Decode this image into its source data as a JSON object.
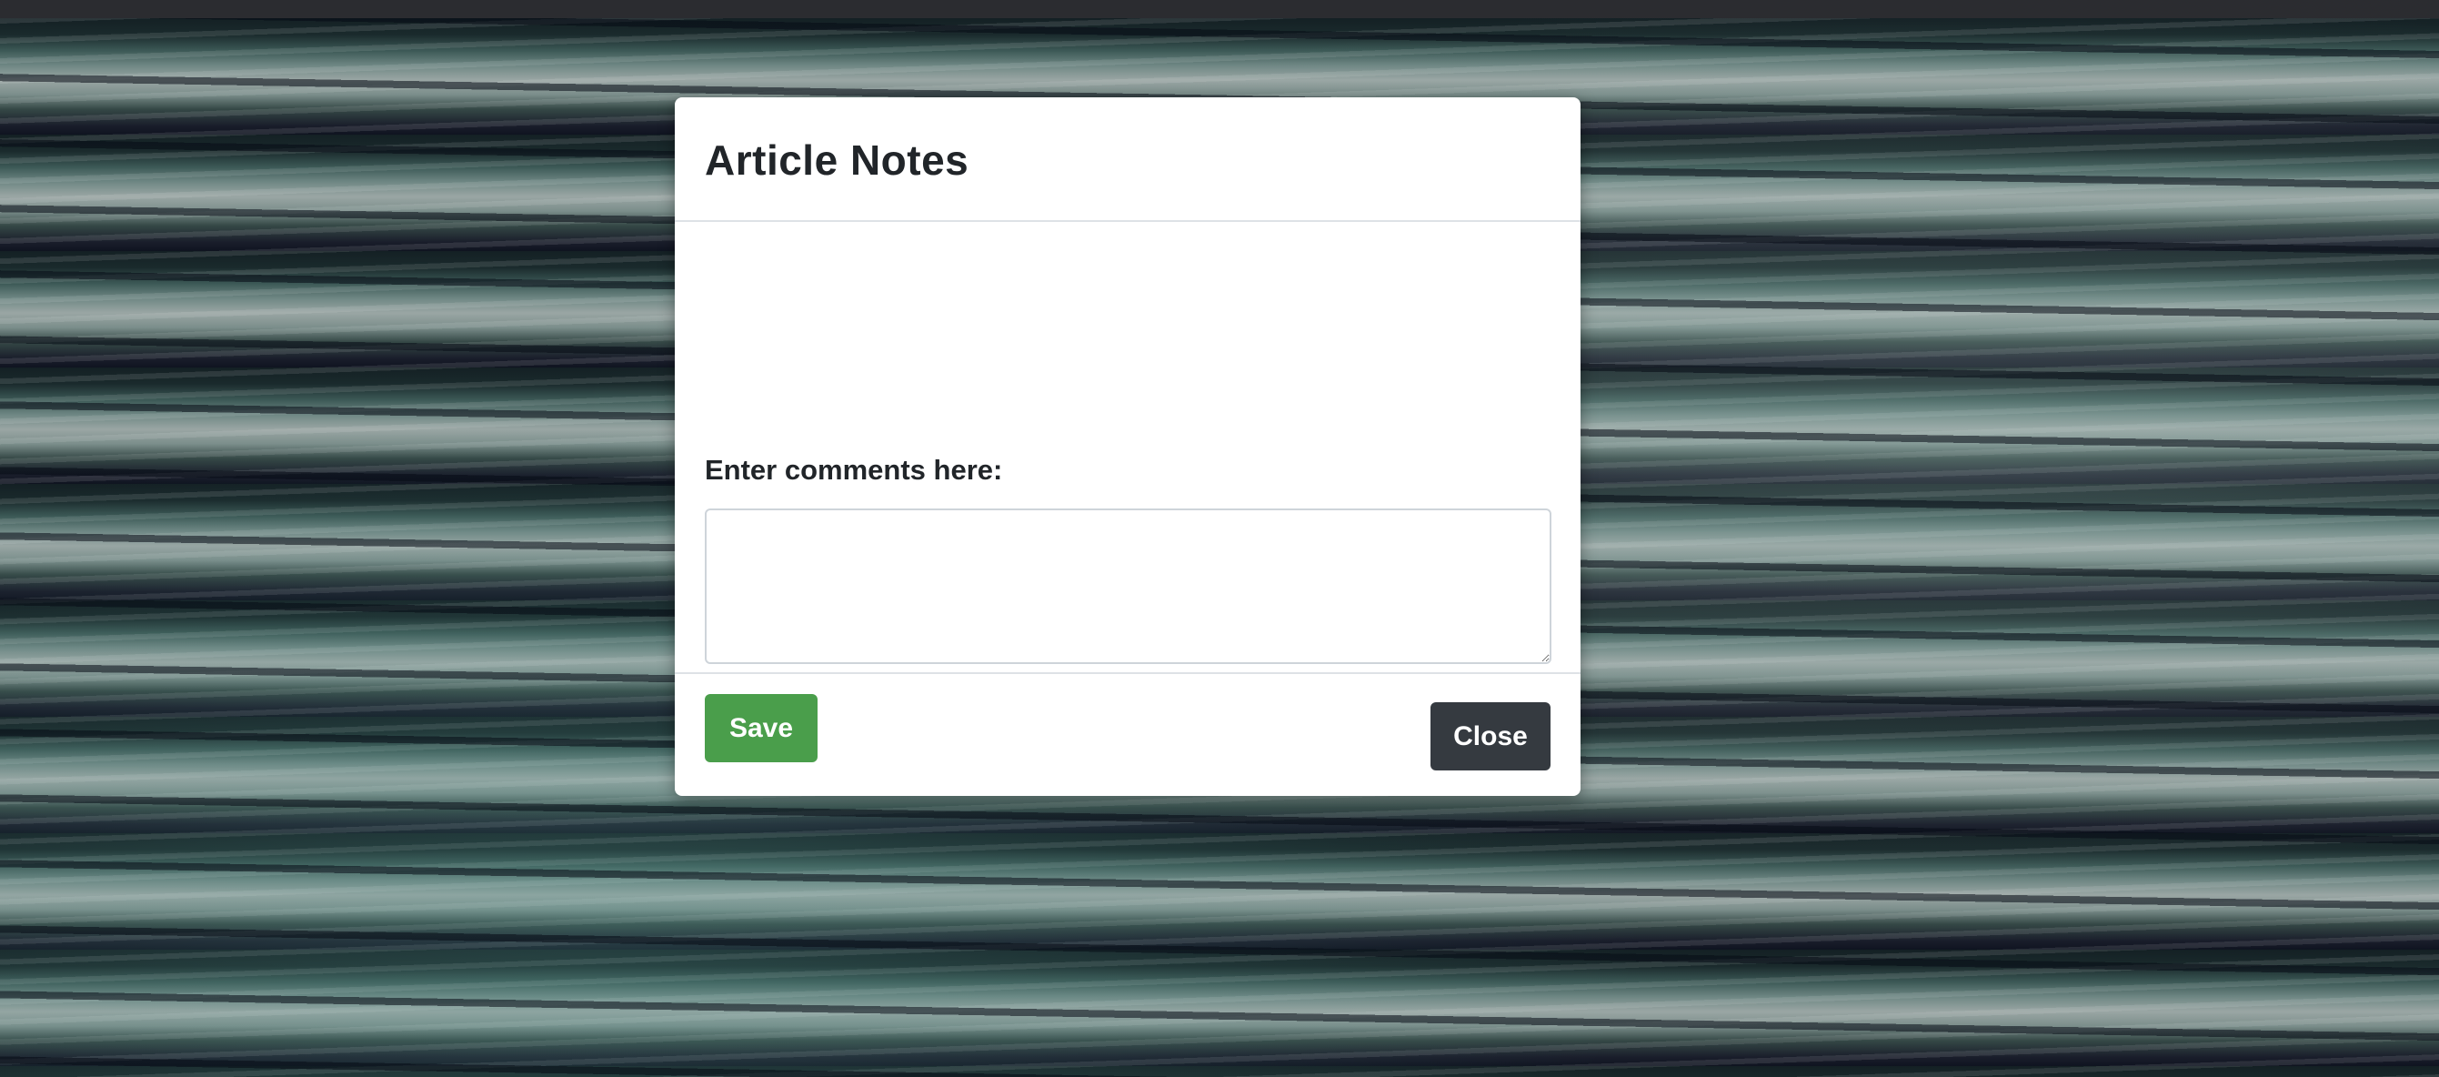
{
  "modal": {
    "title": "Article Notes",
    "field_label": "Enter comments here:",
    "comments_value": "",
    "save_label": "Save",
    "close_label": "Close"
  },
  "colors": {
    "save_button": "#4a9e4b",
    "close_button": "#353a40",
    "modal_background": "#ffffff"
  }
}
